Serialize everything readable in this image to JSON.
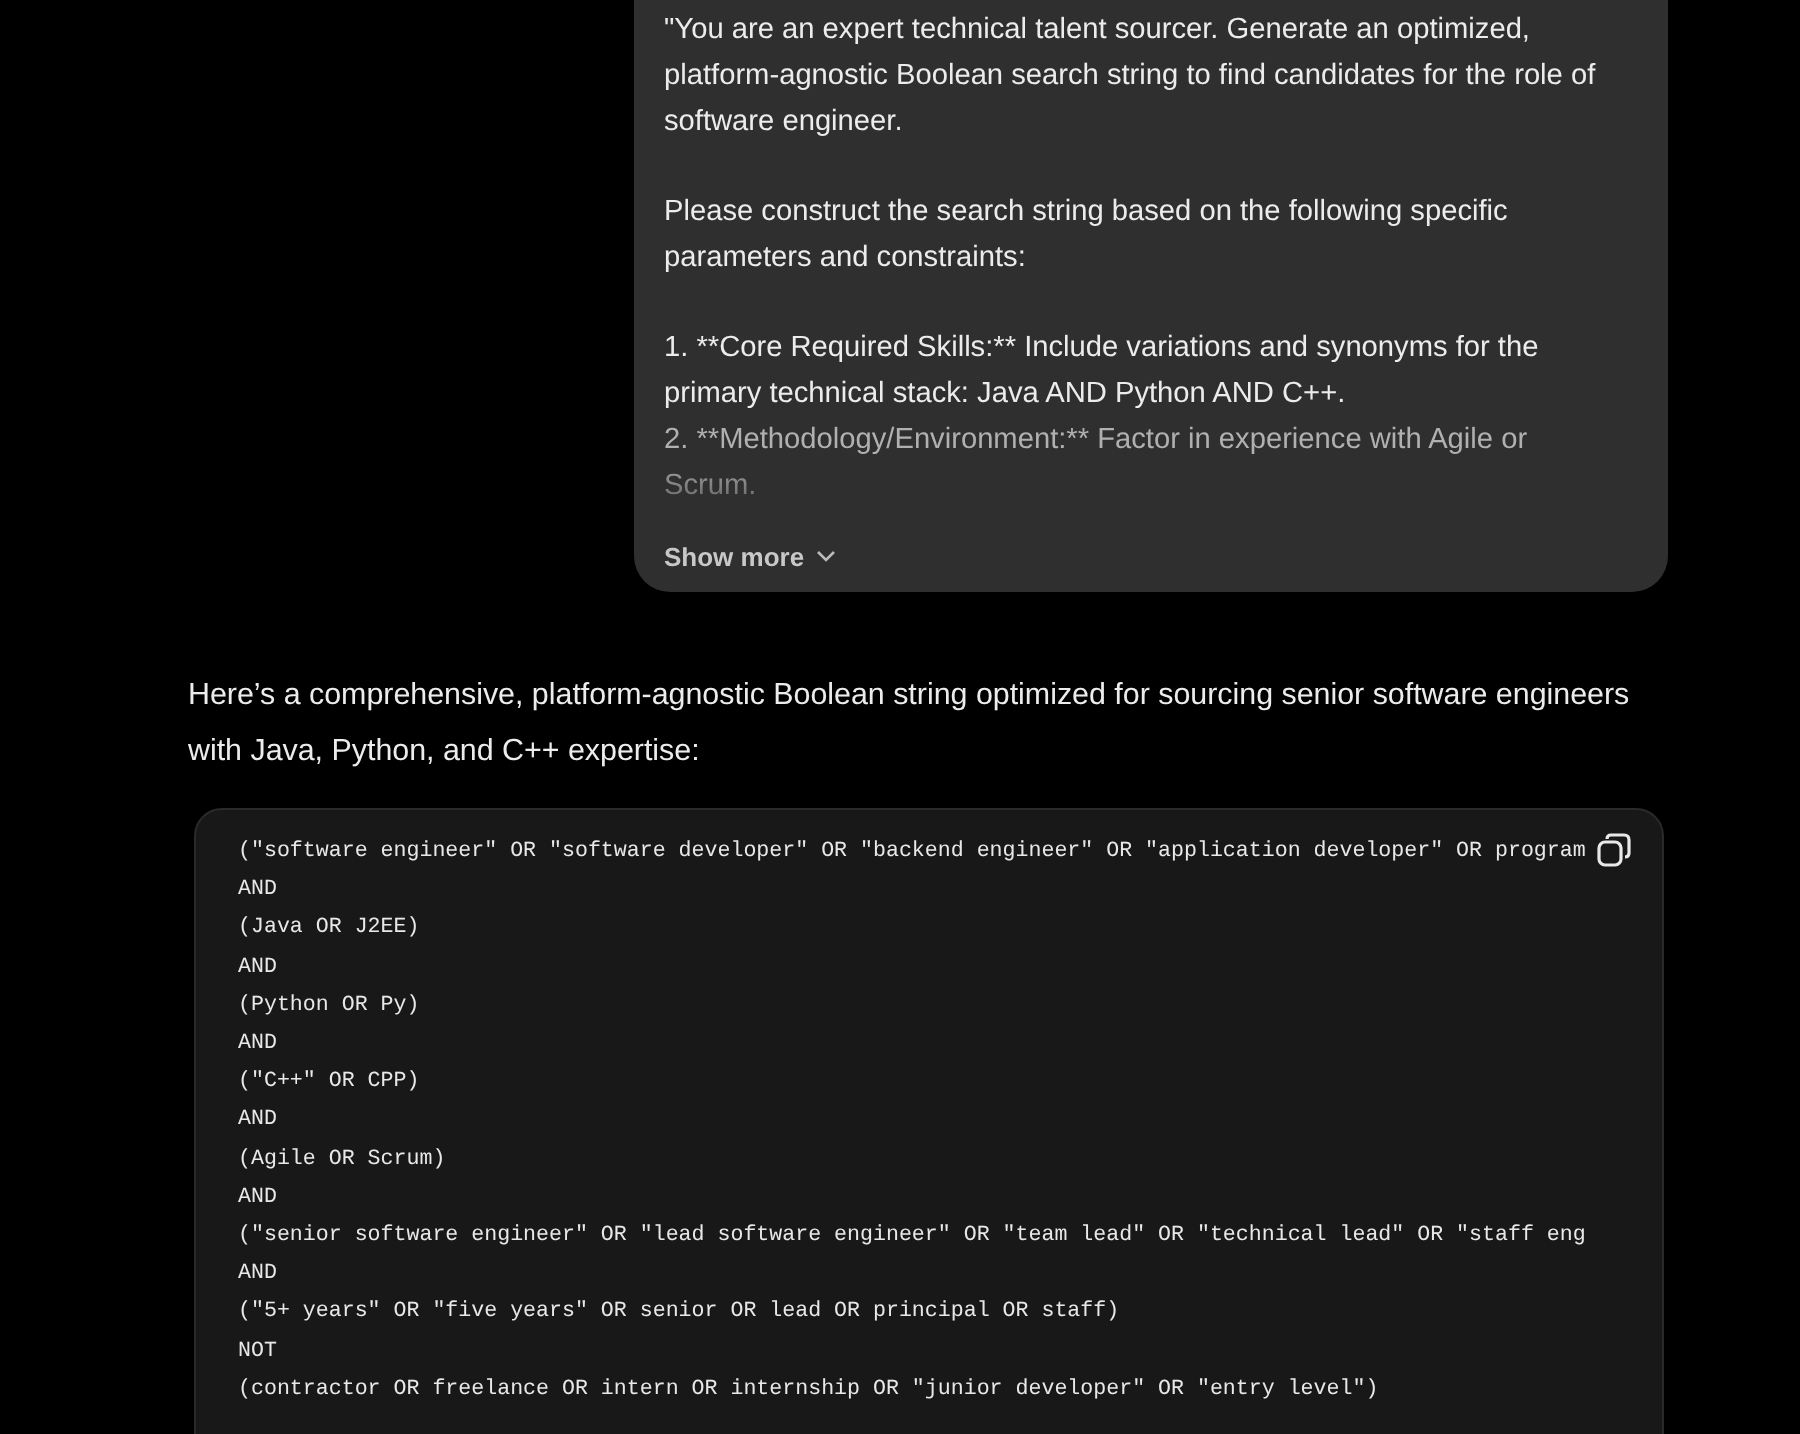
{
  "user_message": {
    "paragraphs": [
      "\"You are an expert technical talent sourcer. Generate an optimized, platform-agnostic Boolean search string to find candidates for the role of software engineer.",
      "Please construct the search string based on the following specific parameters and constraints:",
      "1. **Core Required Skills:** Include variations and synonyms for the primary technical stack: Java AND Python AND C++.",
      "2. **Methodology/Environment:** Factor in experience with Agile or Scrum."
    ],
    "show_more": "Show more"
  },
  "response": {
    "intro": "Here’s a comprehensive, platform-agnostic Boolean string optimized for sourcing senior software engineers with Java, Python, and C++ expertise:",
    "code_lines": [
      "(\"software engineer\" OR \"software developer\" OR \"backend engineer\" OR \"application developer\" OR program",
      "AND",
      "(Java OR J2EE)",
      "AND",
      "(Python OR Py)",
      "AND",
      "(\"C++\" OR CPP)",
      "AND",
      "(Agile OR Scrum)",
      "AND",
      "(\"senior software engineer\" OR \"lead software engineer\" OR \"team lead\" OR \"technical lead\" OR \"staff eng",
      "AND",
      "(\"5+ years\" OR \"five years\" OR senior OR lead OR principal OR staff)",
      "NOT",
      "(contractor OR freelance OR intern OR internship OR \"junior developer\" OR \"entry level\")"
    ]
  }
}
